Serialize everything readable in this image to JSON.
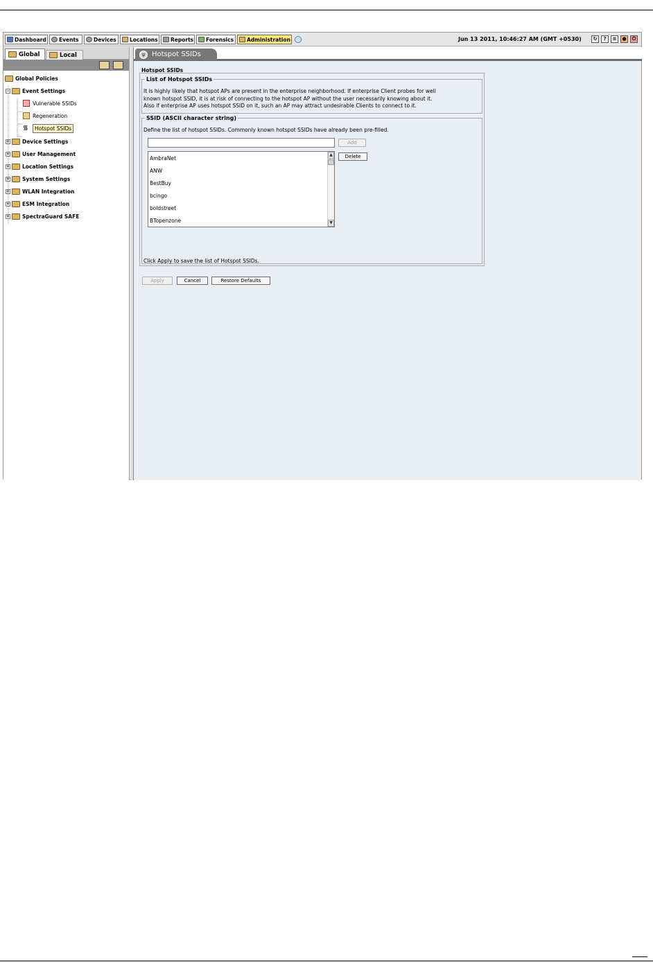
{
  "toolbar": {
    "tabs": [
      {
        "label": "Dashboard",
        "icon": "dashboard-icon"
      },
      {
        "label": "Events",
        "icon": "events-icon"
      },
      {
        "label": "Devices",
        "icon": "devices-icon"
      },
      {
        "label": "Locations",
        "icon": "locations-icon"
      },
      {
        "label": "Reports",
        "icon": "reports-icon"
      },
      {
        "label": "Forensics",
        "icon": "forensics-icon"
      },
      {
        "label": "Administration",
        "icon": "administration-icon"
      }
    ],
    "active_tab": "Administration",
    "datetime": "Jun 13 2011, 10:46:27 AM (GMT +0530)",
    "right_icons": [
      "refresh-icon",
      "help-icon",
      "layout-icon",
      "settings-icon",
      "logout-icon"
    ]
  },
  "left_panel": {
    "tabs": [
      {
        "label": "Global"
      },
      {
        "label": "Local"
      }
    ],
    "tree": {
      "root": "Global Policies",
      "event_settings": "Event Settings",
      "leaves": [
        "Vulnerable SSIDs",
        "Regeneration",
        "Hotspot SSIDs"
      ],
      "selected": "Hotspot SSIDs",
      "nodes": [
        "Device Settings",
        "User Management",
        "Location Settings",
        "System Settings",
        "WLAN Integration",
        "ESM Integration",
        "SpectraGuard SAFE"
      ]
    }
  },
  "content": {
    "tab_label": "Hotspot SSIDs",
    "pane_title": "Hotspot SSIDs",
    "list_group": {
      "legend": "List of Hotspot SSIDs",
      "description": [
        "It is highly likely that hotspot APs are present in the enterprise neighborhood. If enterprise Client probes for well",
        "known hotspot SSID, it is at risk of connecting to the hotspot AP without the user necessarily knowing about it.",
        "Also if enterprise AP uses hotspot SSID on it, such an AP may attract undesirable Clients to connect to it."
      ]
    },
    "ssid_group": {
      "legend": "SSID (ASCII character string)",
      "instructions": "Define the list of hotspot SSIDs. Commonly known hotspot SSIDs have already been pre-filled.",
      "input_value": "",
      "add_label": "Add",
      "delete_label": "Delete",
      "ssids": [
        "AmbraNet",
        "ANW",
        "BestBuy",
        "bcingo",
        "boldstreet",
        "BTopenzone"
      ],
      "footer": "Click Apply to save the list of Hotspot SSIDs."
    },
    "buttons": {
      "apply": "Apply",
      "cancel": "Cancel",
      "restore": "Restore Defaults"
    }
  }
}
